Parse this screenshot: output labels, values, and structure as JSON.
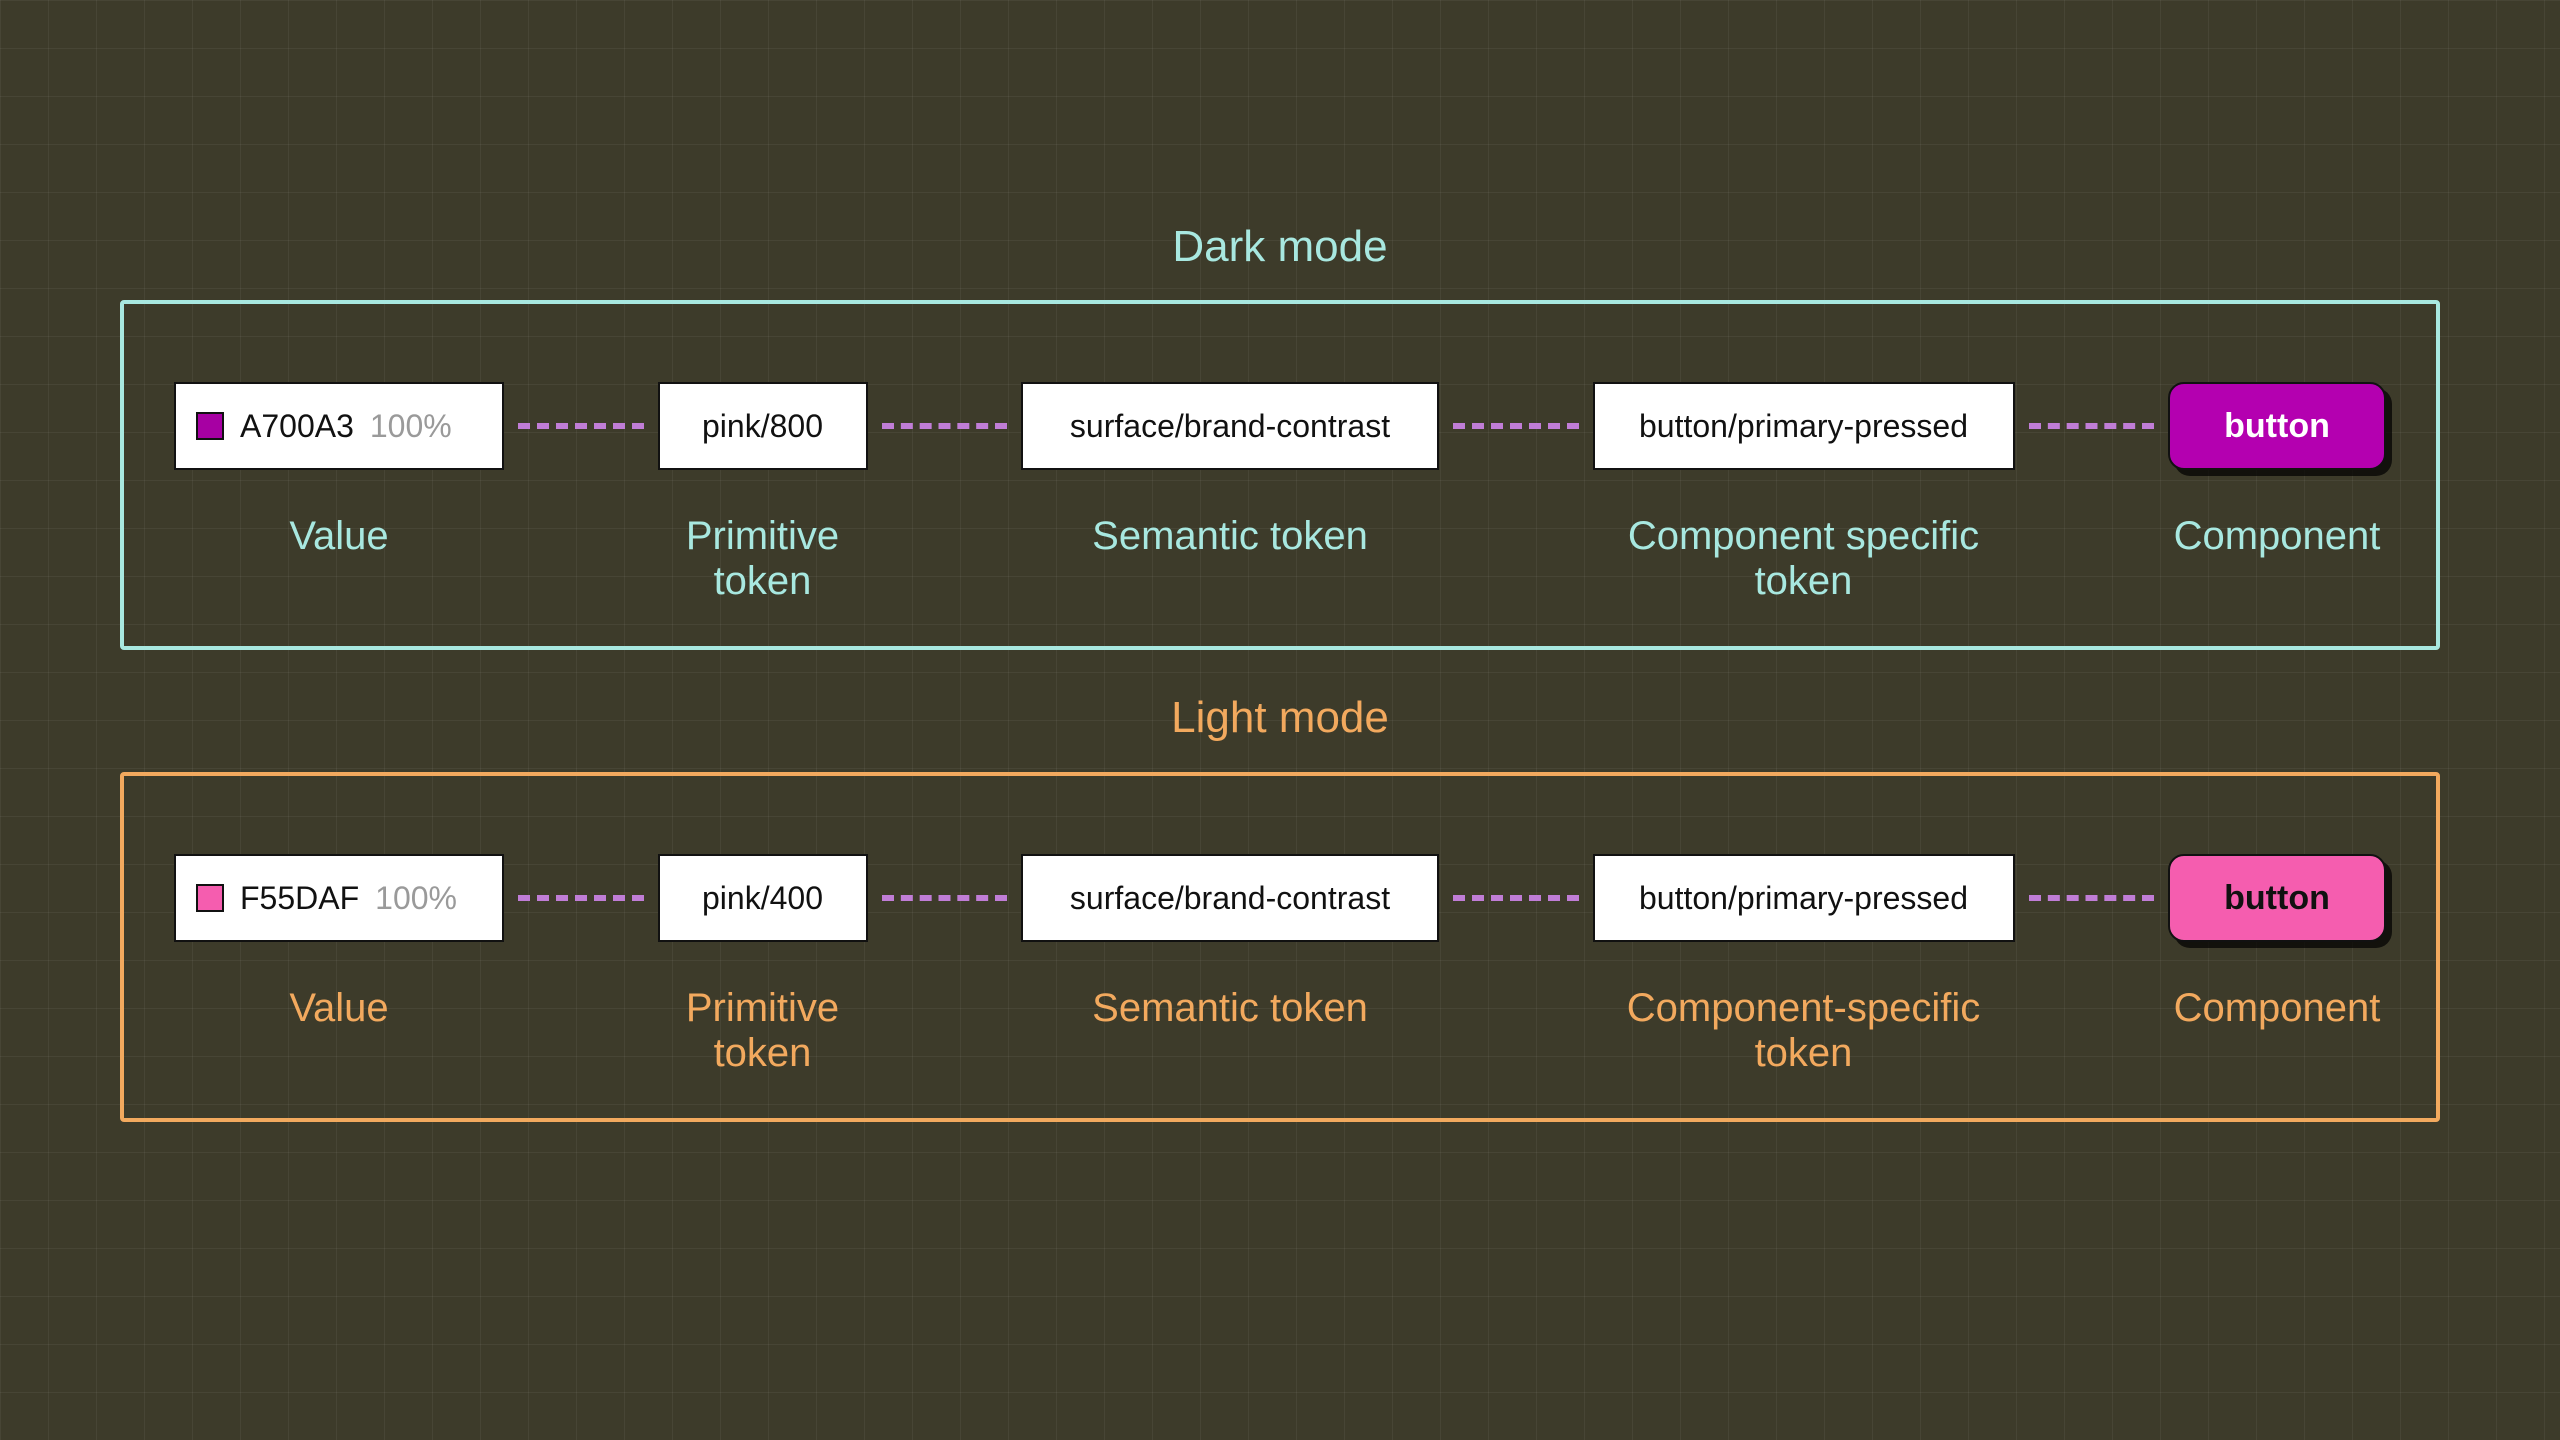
{
  "dark": {
    "title": "Dark mode",
    "border_color": "#a8e8e0",
    "value": {
      "hex": "A700A3",
      "opacity": "100%",
      "swatch": "#a700a3"
    },
    "primitive": "pink/800",
    "semantic": "surface/brand-contrast",
    "component_token": "button/primary-pressed",
    "button_label": "button",
    "button_bg": "#b400b0",
    "labels": {
      "value": "Value",
      "primitive": "Primitive token",
      "semantic": "Semantic token",
      "component_token": "Component specific token",
      "component": "Component"
    }
  },
  "light": {
    "title": "Light mode",
    "border_color": "#f2a95e",
    "value": {
      "hex": "F55DAF",
      "opacity": "100%",
      "swatch": "#f55daf"
    },
    "primitive": "pink/400",
    "semantic": "surface/brand-contrast",
    "component_token": "button/primary-pressed",
    "button_label": "button",
    "button_bg": "#f55daf",
    "labels": {
      "value": "Value",
      "primitive": "Primitive token",
      "semantic": "Semantic token",
      "component_token": "Component-specific token",
      "component": "Component"
    }
  }
}
